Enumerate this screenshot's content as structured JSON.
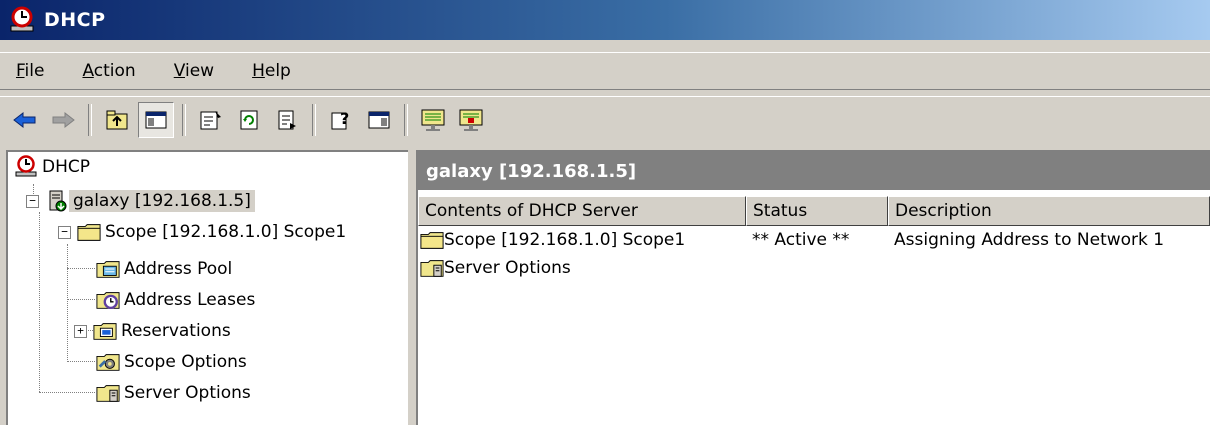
{
  "window": {
    "title": "DHCP"
  },
  "menu": [
    {
      "underline": "F",
      "rest": "ile"
    },
    {
      "underline": "A",
      "rest": "ction"
    },
    {
      "underline": "V",
      "rest": "iew"
    },
    {
      "underline": "H",
      "rest": "elp"
    }
  ],
  "toolbar": {
    "buttons": [
      "back-arrow-icon",
      "forward-arrow-icon",
      "up-folder-icon",
      "show-hide-tree-icon",
      "properties-icon",
      "refresh-icon",
      "export-list-icon",
      "help-icon",
      "show-hide-action-pane-icon",
      "server-statistics-icon",
      "display-statistics-icon"
    ]
  },
  "tree": {
    "root": "DHCP",
    "server": "galaxy [192.168.1.5]",
    "scope": "Scope [192.168.1.0] Scope1",
    "scope_children": [
      "Address Pool",
      "Address Leases",
      "Reservations",
      "Scope Options"
    ],
    "server_options": "Server Options"
  },
  "detail": {
    "header": "galaxy [192.168.1.5]",
    "columns": [
      "Contents of DHCP Server",
      "Status",
      "Description"
    ],
    "rows": [
      {
        "name": "Scope [192.168.1.0] Scope1",
        "status": "** Active **",
        "description": "Assigning Address to Network 1"
      },
      {
        "name": "Server Options",
        "status": "",
        "description": ""
      }
    ]
  }
}
